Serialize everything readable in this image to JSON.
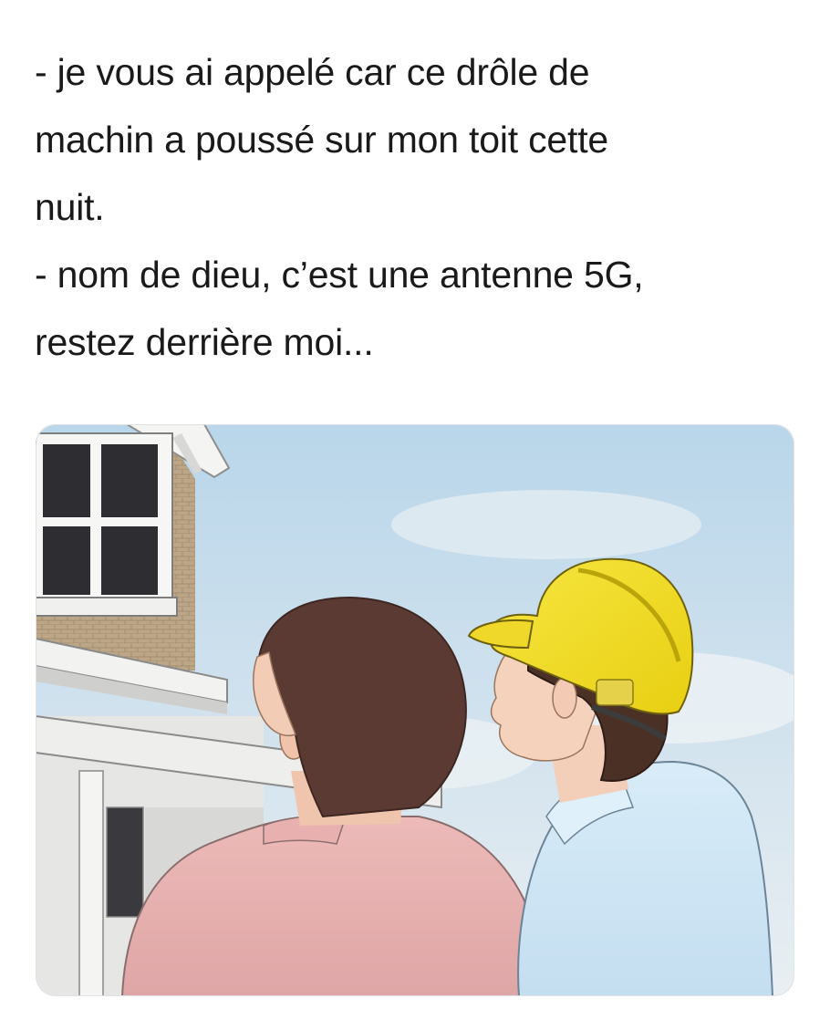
{
  "post": {
    "caption_lines": [
      "- je vous ai appelé car ce drôle de",
      "machin a poussé sur mon toit cette",
      "nuit.",
      "- nom de dieu, c’est une antenne 5G,",
      "restez derrière moi..."
    ]
  },
  "illustration": {
    "subject": "two men looking up at a roof, one wearing a yellow hard hat",
    "colors": {
      "sky_top": "#b9d6ea",
      "sky_bottom": "#e6eef2",
      "hard_hat": "#f2dc1f",
      "shirt_left": "#e7b2b1",
      "shirt_right": "#cfe6f4",
      "hair": "#5a3a33",
      "skin": "#f3ccb6",
      "wall": "#b9a283"
    }
  }
}
